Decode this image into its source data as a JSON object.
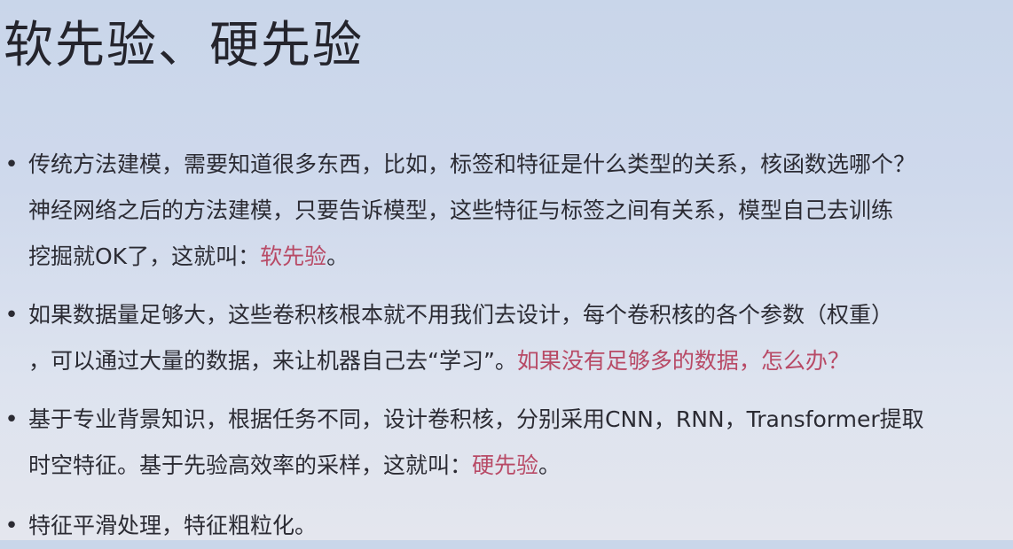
{
  "slide": {
    "title": "软先验、硬先验",
    "bullet_glyph": "•",
    "bullets": [
      {
        "line1": "传统方法建模，需要知道很多东西，比如，标签和特征是什么类型的关系，核函数选哪个？",
        "line2": "神经网络之后的方法建模，只要告诉模型，这些特征与标签之间有关系，模型自己去训练",
        "line3_prefix": "挖掘就OK了，这就叫：",
        "line3_highlight": "软先验",
        "line3_suffix": "。"
      },
      {
        "line1": "如果数据量足够大，这些卷积核根本就不用我们去设计，每个卷积核的各个参数（权重）",
        "line2_prefix": "，可以通过大量的数据，来让机器自己去“学习”。",
        "line2_highlight": "如果没有足够多的数据，怎么办？"
      },
      {
        "line1": "基于专业背景知识，根据任务不同，设计卷积核，分别采用CNN，RNN，Transformer提取",
        "line2_prefix": "时空特征。基于先验高效率的采样，这就叫：",
        "line2_highlight": "硬先验",
        "line2_suffix": "。"
      },
      {
        "line1": "特征平滑处理，特征粗粒化。"
      }
    ],
    "colors": {
      "text": "#2b2b33",
      "highlight": "#b84a66",
      "background_top": "#c9d6ea",
      "background_bottom": "#e4e6ee"
    }
  }
}
